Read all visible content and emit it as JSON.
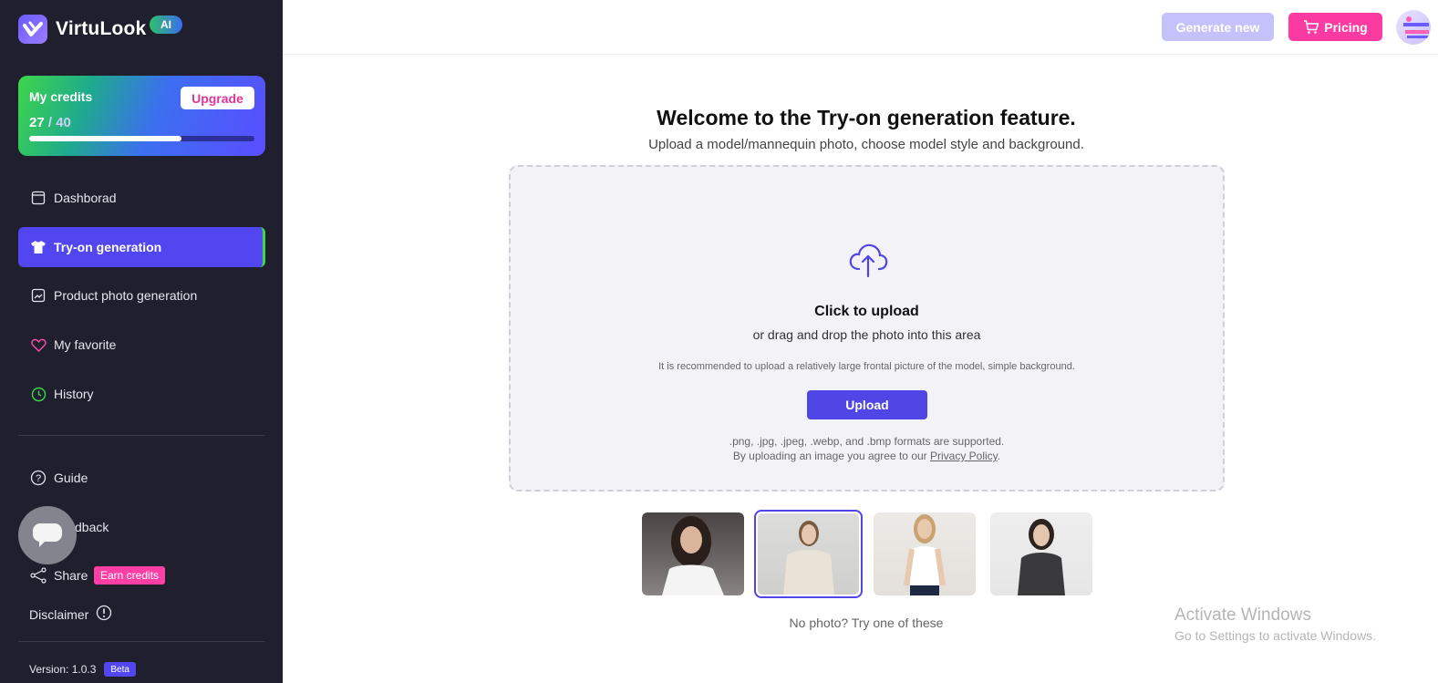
{
  "app": {
    "name": "VirtuLook",
    "badge": "AI"
  },
  "credits": {
    "label": "My credits",
    "upgrade": "Upgrade",
    "used": "27",
    "separator": " / ",
    "total": "40",
    "fraction": 0.675
  },
  "nav": {
    "dashboard": "Dashborad",
    "tryon": "Try-on generation",
    "product": "Product photo generation",
    "favorite": "My favorite",
    "history": "History",
    "guide": "Guide",
    "feedback": "dback",
    "share": "Share",
    "earn": "Earn credits",
    "disclaimer": "Disclaimer"
  },
  "version": {
    "text": "Version: 1.0.3",
    "badge": "Beta"
  },
  "topbar": {
    "generate_new": "Generate new",
    "pricing": "Pricing"
  },
  "main": {
    "title": "Welcome to the Try-on generation feature.",
    "subtitle": "Upload a model/mannequin photo, choose model style and background.",
    "click_upload": "Click to upload",
    "drag_text": "or drag and drop the photo into this area",
    "recommend": "It is recommended to upload a relatively large frontal picture of the model, simple background.",
    "upload_button": "Upload",
    "formats": ".png, .jpg, .jpeg, .webp, and .bmp formats are supported.",
    "agree_prefix": "By uploading an image you agree to our ",
    "agree_link": "Privacy Policy",
    "agree_suffix": ".",
    "try_text": "No photo? Try one of these"
  },
  "watermark": {
    "line1": "Activate Windows",
    "line2": "Go to Settings to activate Windows."
  },
  "colors": {
    "sidebar_bg": "#1f1f2e",
    "accent": "#4f46e5",
    "pink": "#fb3ba2"
  }
}
